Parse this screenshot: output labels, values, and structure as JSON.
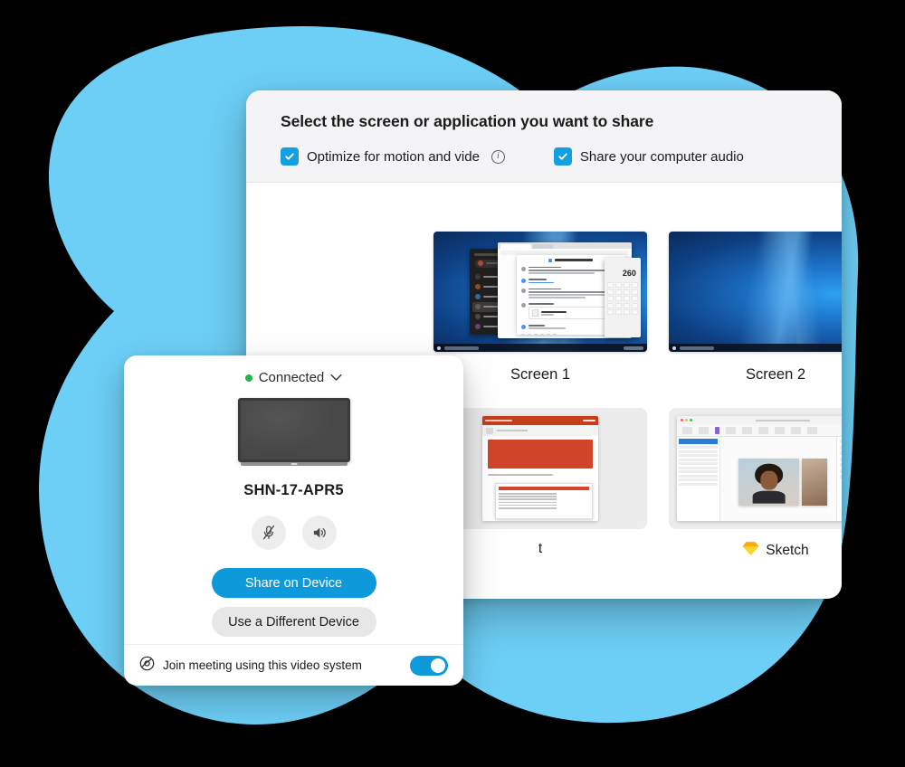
{
  "theme": {
    "blob_color": "#6DCFF6",
    "accent_blue": "#0E9ADA",
    "checkbox_blue": "#13A0E0",
    "status_green": "#25B24B",
    "page_background": "#000000",
    "dialog_header_bg": "#F4F4F7",
    "selected_card_bg": "#EAF6FD"
  },
  "share_dialog": {
    "title": "Select the screen or application you want to share",
    "options": [
      {
        "label": "Optimize for motion and vide",
        "checked": true,
        "has_info_icon": true,
        "icon": "info-icon"
      },
      {
        "label": "Share your computer audio",
        "checked": true,
        "has_info_icon": false
      }
    ],
    "screens": [
      {
        "label": "Screen 1",
        "selected": false,
        "preview": "windows-desktop-chat-browser-calculator",
        "calculator_value": "260"
      },
      {
        "label": "Screen 2",
        "selected": false,
        "preview": "windows-desktop-wallpaper"
      }
    ],
    "applications": [
      {
        "label": "t",
        "full_label_truncated": true,
        "selected": false,
        "preview": "powerpoint-window",
        "icon": "powerpoint-icon"
      },
      {
        "label": "Sketch",
        "selected": false,
        "preview": "sketch-window",
        "icon": "sketch-diamond-icon"
      },
      {
        "label": "",
        "selected": true,
        "preview": "acrobat-window",
        "icon": "acrobat-icon"
      }
    ]
  },
  "device_card": {
    "status": {
      "text": "Connected",
      "dot_color": "#25B24B",
      "chevron": "chevron-down-icon"
    },
    "device_image_alt": "video-system-display",
    "device_name": "SHN-17-APR5",
    "media_buttons": [
      {
        "name": "microphone-muted-icon",
        "state": "muted"
      },
      {
        "name": "speaker-icon",
        "state": "on"
      }
    ],
    "primary_button": "Share on Device",
    "secondary_button": "Use a Different Device",
    "footer": {
      "icon": "video-system-icon",
      "label": "Join meeting using this video system",
      "toggle_on": true
    }
  }
}
